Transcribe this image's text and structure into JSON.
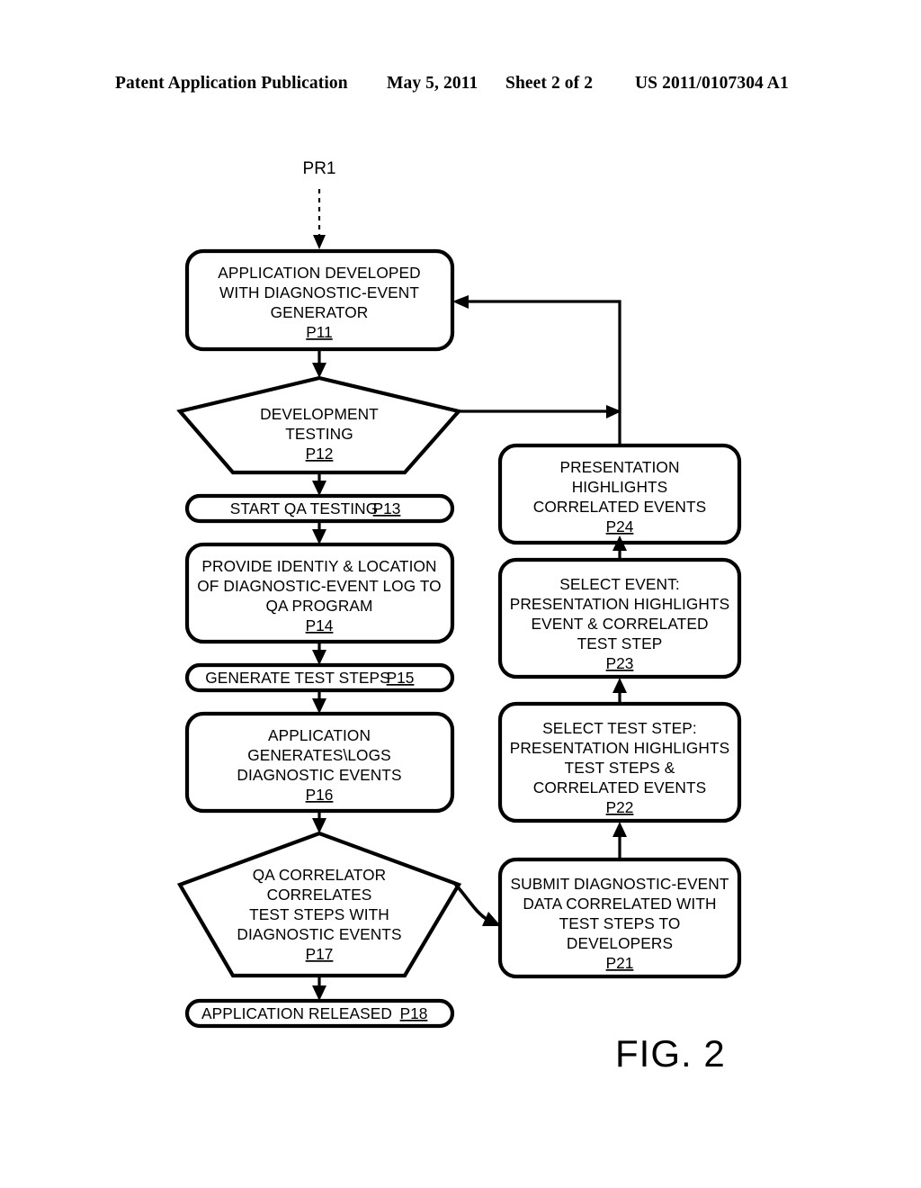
{
  "header": {
    "publication": "Patent Application Publication",
    "date": "May 5, 2011",
    "sheet": "Sheet 2 of 2",
    "doc_number": "US 2011/0107304 A1"
  },
  "figure": {
    "caption": "FIG. 2",
    "entry_label": "PR1"
  },
  "nodes": {
    "p11": {
      "ref": "P11",
      "shape": "rounded-rect",
      "lines": [
        "APPLICATION DEVELOPED",
        "WITH DIAGNOSTIC-EVENT",
        "GENERATOR"
      ]
    },
    "p12": {
      "ref": "P12",
      "shape": "pentagon",
      "lines": [
        "DEVELOPMENT",
        "TESTING"
      ]
    },
    "p13": {
      "ref": "P13",
      "shape": "pill",
      "lines": [
        "START QA TESTING"
      ]
    },
    "p14": {
      "ref": "P14",
      "shape": "rounded-rect",
      "lines": [
        "PROVIDE IDENTIY & LOCATION",
        "OF DIAGNOSTIC-EVENT LOG TO",
        "QA PROGRAM"
      ]
    },
    "p15": {
      "ref": "P15",
      "shape": "pill",
      "lines": [
        "GENERATE TEST STEPS"
      ]
    },
    "p16": {
      "ref": "P16",
      "shape": "rounded-rect",
      "lines": [
        "APPLICATION",
        "GENERATES\\LOGS",
        "DIAGNOSTIC EVENTS"
      ]
    },
    "p17": {
      "ref": "P17",
      "shape": "pentagon",
      "lines": [
        "QA CORRELATOR",
        "CORRELATES",
        "TEST STEPS WITH",
        "DIAGNOSTIC EVENTS"
      ]
    },
    "p18": {
      "ref": "P18",
      "shape": "pill",
      "lines": [
        "APPLICATION RELEASED"
      ]
    },
    "p21": {
      "ref": "P21",
      "shape": "rounded-rect",
      "lines": [
        "SUBMIT DIAGNOSTIC-EVENT",
        "DATA CORRELATED WITH",
        "TEST STEPS TO",
        "DEVELOPERS"
      ]
    },
    "p22": {
      "ref": "P22",
      "shape": "rounded-rect",
      "lines": [
        "SELECT TEST STEP:",
        "PRESENTATION HIGHLIGHTS",
        "TEST STEPS &",
        "CORRELATED EVENTS"
      ]
    },
    "p23": {
      "ref": "P23",
      "shape": "rounded-rect",
      "lines": [
        "SELECT EVENT:",
        "PRESENTATION HIGHLIGHTS",
        "EVENT & CORRELATED",
        "TEST STEP"
      ]
    },
    "p24": {
      "ref": "P24",
      "shape": "rounded-rect",
      "lines": [
        "PRESENTATION",
        "HIGHLIGHTS",
        "CORRELATED EVENTS"
      ]
    }
  },
  "edges": [
    {
      "name": "entry-to-p11",
      "from": "PR1",
      "to": "P11",
      "style": "dashed"
    },
    {
      "name": "p11-to-p12",
      "from": "P11",
      "to": "P12",
      "style": "solid"
    },
    {
      "name": "p12-to-p13",
      "from": "P12",
      "to": "P13",
      "style": "solid"
    },
    {
      "name": "p13-to-p14",
      "from": "P13",
      "to": "P14",
      "style": "solid"
    },
    {
      "name": "p14-to-p15",
      "from": "P14",
      "to": "P15",
      "style": "solid"
    },
    {
      "name": "p15-to-p16",
      "from": "P15",
      "to": "P16",
      "style": "solid"
    },
    {
      "name": "p16-to-p17",
      "from": "P16",
      "to": "P17",
      "style": "solid"
    },
    {
      "name": "p17-to-p18",
      "from": "P17",
      "to": "P18",
      "style": "solid"
    },
    {
      "name": "p17-to-p21",
      "from": "P17",
      "to": "P21",
      "style": "curved"
    },
    {
      "name": "p21-to-p22",
      "from": "P21",
      "to": "P22",
      "style": "solid"
    },
    {
      "name": "p22-to-p23",
      "from": "P22",
      "to": "P23",
      "style": "solid"
    },
    {
      "name": "p23-to-p24",
      "from": "P23",
      "to": "P24",
      "style": "solid"
    },
    {
      "name": "p24-to-p11",
      "from": "P24",
      "to": "P11",
      "style": "feedback"
    },
    {
      "name": "p12-to-loop",
      "from": "P12",
      "to": "P11",
      "style": "feedback-join"
    }
  ],
  "colors": {
    "background": "#ffffff",
    "ink": "#000000"
  }
}
